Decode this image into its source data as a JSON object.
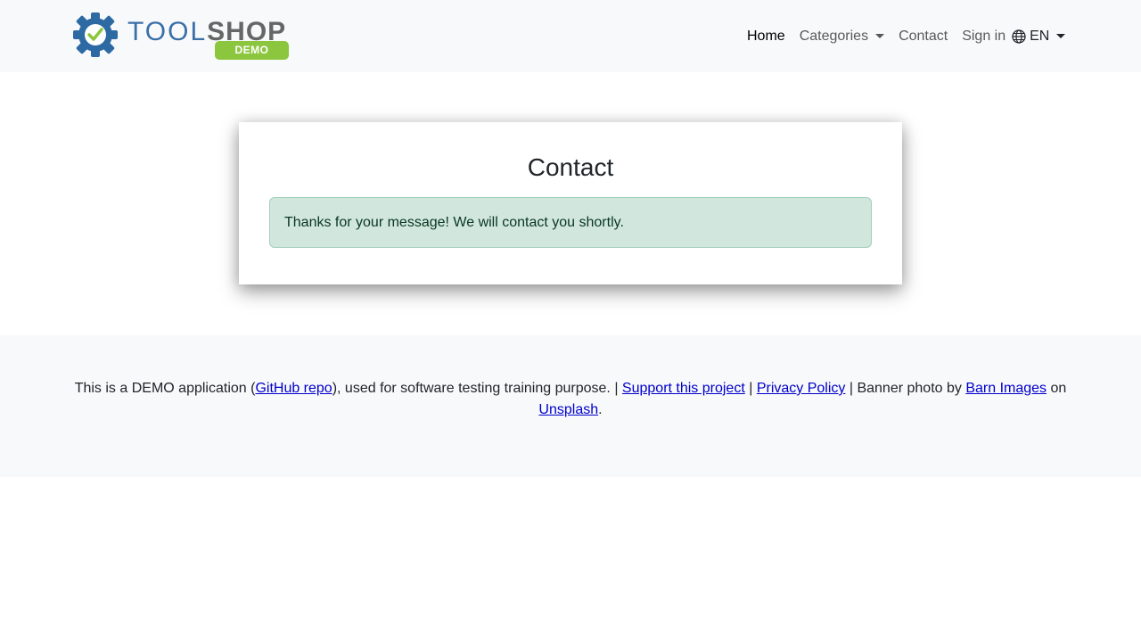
{
  "navbar": {
    "brand": {
      "tool": "TOOL",
      "shop": "SHOP",
      "demo": "DEMO",
      "icon": "gear-check-icon"
    },
    "links": {
      "home": "Home",
      "categories": "Categories",
      "contact": "Contact",
      "sign_in": "Sign in",
      "language": "EN"
    },
    "language_icon": "globe-icon"
  },
  "contact_card": {
    "title": "Contact",
    "alert_message": "Thanks for your message! We will contact you shortly."
  },
  "footer": {
    "text_1": "This is a DEMO application (",
    "github_link": "GitHub repo",
    "text_2": "), used for software testing training purpose. | ",
    "support_link": "Support this project",
    "text_3": " | ",
    "privacy_link": "Privacy Policy",
    "text_4": " | Banner photo by ",
    "barn_link": "Barn Images",
    "text_5": " on ",
    "unsplash_link": "Unsplash",
    "text_6": "."
  },
  "colors": {
    "navbar_bg": "#f8f9fa",
    "alert_bg": "#d1e7dd",
    "alert_border": "#a3cfbb",
    "alert_text": "#0a3622",
    "brand_blue": "#3a6fa8",
    "brand_green": "#8cc63f",
    "brand_grey": "#666666"
  }
}
